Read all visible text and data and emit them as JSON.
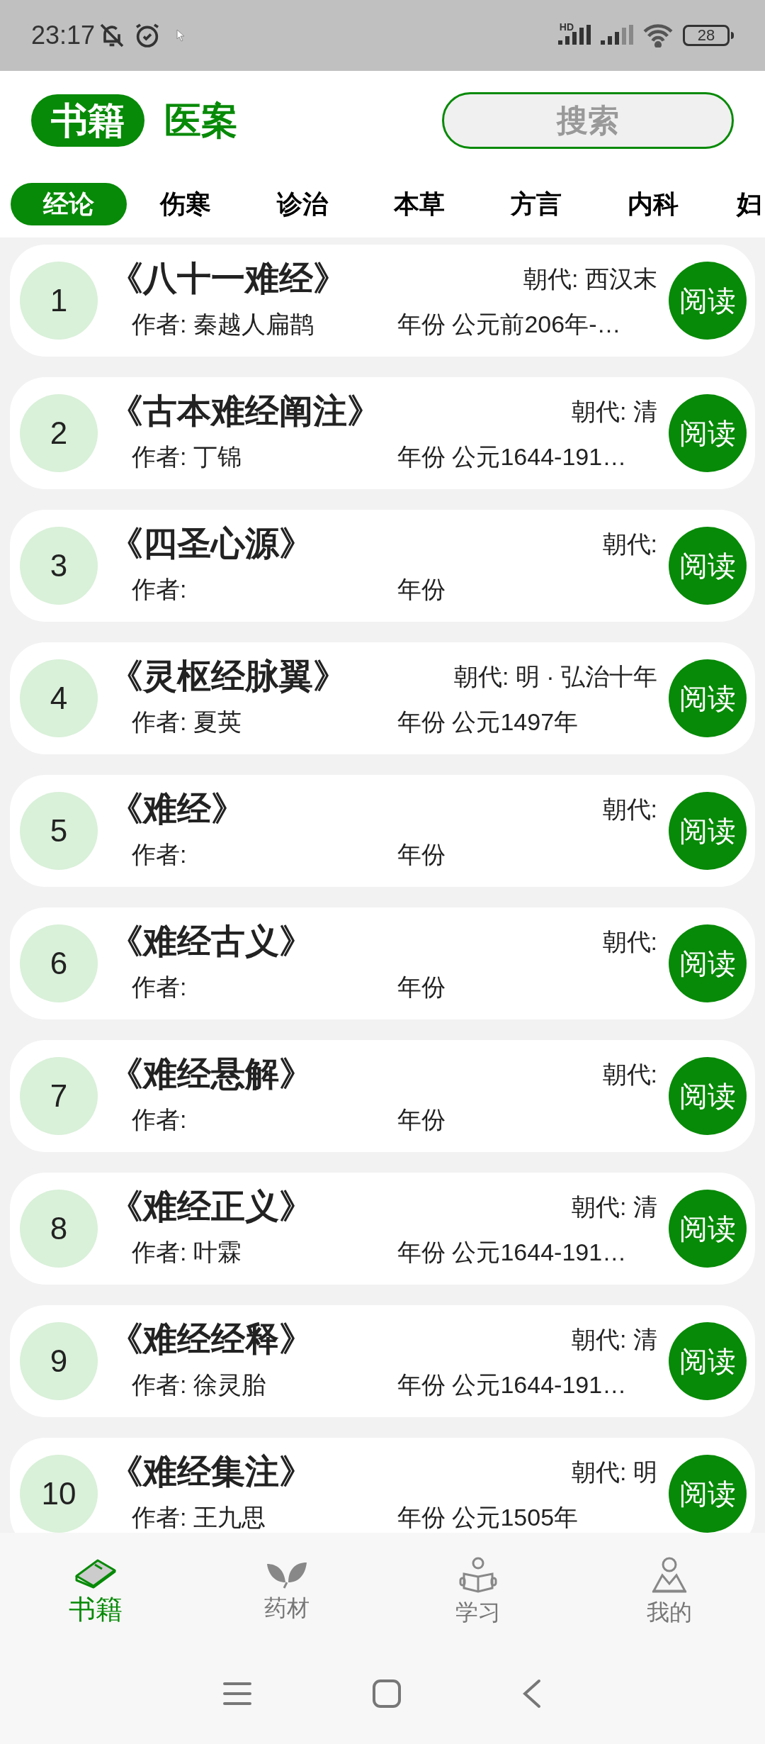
{
  "status_bar": {
    "time": "23:17",
    "hd_label": "HD",
    "battery": "28"
  },
  "top_tabs": [
    {
      "label": "书籍",
      "selected": true
    },
    {
      "label": "医案",
      "selected": false
    }
  ],
  "search": {
    "placeholder": "搜索"
  },
  "categories": [
    {
      "label": "经论",
      "selected": true
    },
    {
      "label": "伤寒",
      "selected": false
    },
    {
      "label": "诊治",
      "selected": false
    },
    {
      "label": "本草",
      "selected": false
    },
    {
      "label": "方言",
      "selected": false
    },
    {
      "label": "内科",
      "selected": false
    },
    {
      "label": "妇",
      "selected": false
    }
  ],
  "books": [
    {
      "number": "1",
      "title": "《八十一难经》",
      "dynasty": "朝代: 西汉末",
      "author": "作者: 秦越人扁鹊",
      "year": "年份 公元前206年-…",
      "action": "阅读"
    },
    {
      "number": "2",
      "title": "《古本难经阐注》",
      "dynasty": "朝代: 清",
      "author": "作者: 丁锦",
      "year": "年份 公元1644-191…",
      "action": "阅读"
    },
    {
      "number": "3",
      "title": "《四圣心源》",
      "dynasty": "朝代:",
      "author": "作者:",
      "year": "年份",
      "action": "阅读"
    },
    {
      "number": "4",
      "title": "《灵枢经脉翼》",
      "dynasty": "朝代: 明 · 弘治十年",
      "author": "作者: 夏英",
      "year": "年份 公元1497年",
      "action": "阅读"
    },
    {
      "number": "5",
      "title": "《难经》",
      "dynasty": "朝代:",
      "author": "作者:",
      "year": "年份",
      "action": "阅读"
    },
    {
      "number": "6",
      "title": "《难经古义》",
      "dynasty": "朝代:",
      "author": "作者:",
      "year": "年份",
      "action": "阅读"
    },
    {
      "number": "7",
      "title": "《难经悬解》",
      "dynasty": "朝代:",
      "author": "作者:",
      "year": "年份",
      "action": "阅读"
    },
    {
      "number": "8",
      "title": "《难经正义》",
      "dynasty": "朝代: 清",
      "author": "作者: 叶霖",
      "year": "年份 公元1644-191…",
      "action": "阅读"
    },
    {
      "number": "9",
      "title": "《难经经释》",
      "dynasty": "朝代: 清",
      "author": "作者: 徐灵胎",
      "year": "年份 公元1644-191…",
      "action": "阅读"
    },
    {
      "number": "10",
      "title": "《难经集注》",
      "dynasty": "朝代: 明",
      "author": "作者: 王九思",
      "year": "年份 公元1505年",
      "action": "阅读"
    }
  ],
  "bottom_nav": [
    {
      "label": "书籍",
      "kind": "book",
      "selected": true
    },
    {
      "label": "药材",
      "kind": "leaf",
      "selected": false
    },
    {
      "label": "学习",
      "kind": "reader",
      "selected": false
    },
    {
      "label": "我的",
      "kind": "person",
      "selected": false
    }
  ]
}
